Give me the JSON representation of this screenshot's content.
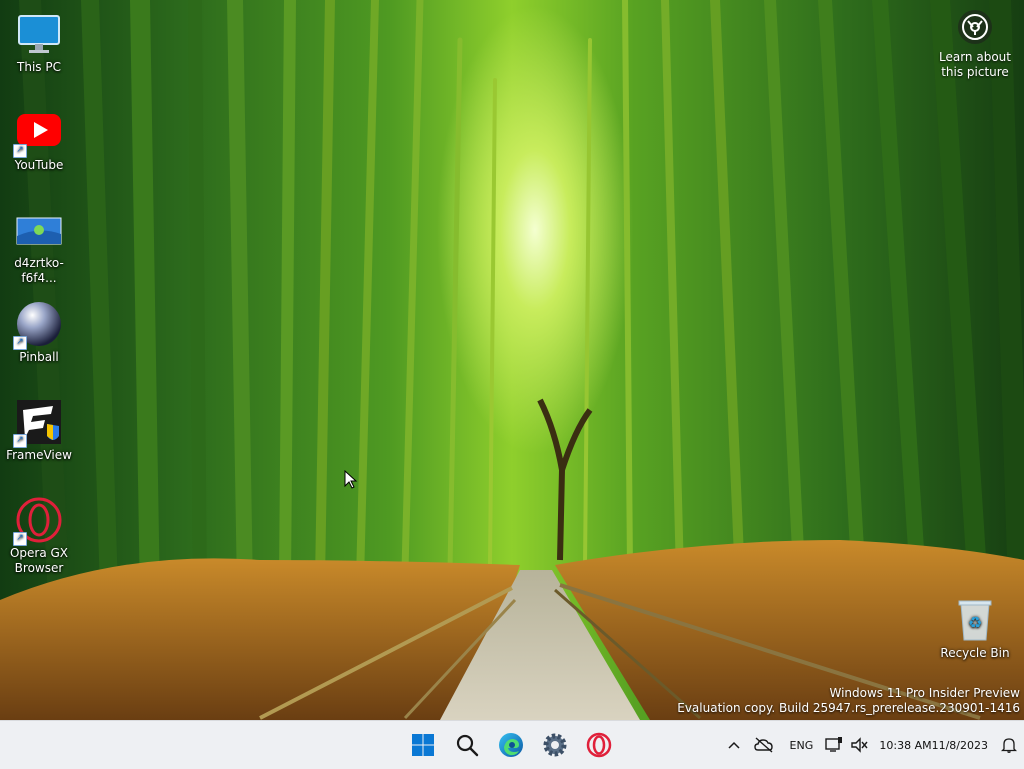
{
  "desktop": {
    "icons": [
      {
        "label": "This PC"
      },
      {
        "label": "YouTube"
      },
      {
        "label": "d4zrtko-f6f4..."
      },
      {
        "label": "Pinball"
      },
      {
        "label": "FrameView"
      },
      {
        "label": "Opera GX Browser"
      },
      {
        "label": "Recycle Bin"
      }
    ],
    "learn_about": "Learn about this picture"
  },
  "watermark": {
    "line1": "Windows 11 Pro Insider Preview",
    "line2": "Evaluation copy. Build 25947.rs_prerelease.230901-1416"
  },
  "taskbar": {
    "apps": [
      {
        "icon": "windows-start-icon"
      },
      {
        "icon": "search-icon"
      },
      {
        "icon": "edge-icon"
      },
      {
        "icon": "settings-gear-icon"
      },
      {
        "icon": "opera-gx-icon"
      }
    ],
    "tray": {
      "language": "ENG",
      "time": "10:38 AM",
      "date": "11/8/2023"
    }
  },
  "colors": {
    "taskbar_bg": "#eef0f3",
    "windows_blue": "#0a78d4",
    "youtube_red": "#ff0000",
    "opera_red": "#e0203a"
  }
}
